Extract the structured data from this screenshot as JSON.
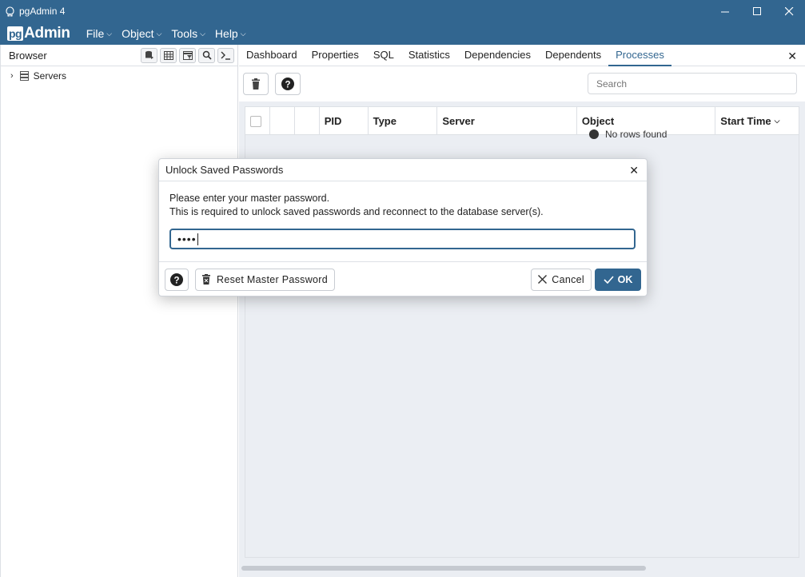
{
  "window": {
    "title": "pgAdmin 4"
  },
  "menubar": {
    "logo_pg": "pg",
    "logo_admin": "Admin",
    "items": [
      "File",
      "Object",
      "Tools",
      "Help"
    ]
  },
  "browser": {
    "label": "Browser",
    "tree": [
      {
        "label": "Servers"
      }
    ]
  },
  "tabs": [
    "Dashboard",
    "Properties",
    "SQL",
    "Statistics",
    "Dependencies",
    "Dependents",
    "Processes"
  ],
  "active_tab": "Processes",
  "toolbar": {
    "search_placeholder": "Search"
  },
  "grid": {
    "columns": [
      "PID",
      "Type",
      "Server",
      "Object",
      "Start Time"
    ],
    "empty_message": "No rows found"
  },
  "dialog": {
    "title": "Unlock Saved Passwords",
    "line1": "Please enter your master password.",
    "line2": "This is required to unlock saved passwords and reconnect to the database server(s).",
    "password_mask": "••••",
    "reset_label": "Reset Master Password",
    "cancel_label": "Cancel",
    "ok_label": "OK"
  },
  "colors": {
    "brand": "#326690",
    "panel_bg": "#ebeef3"
  }
}
